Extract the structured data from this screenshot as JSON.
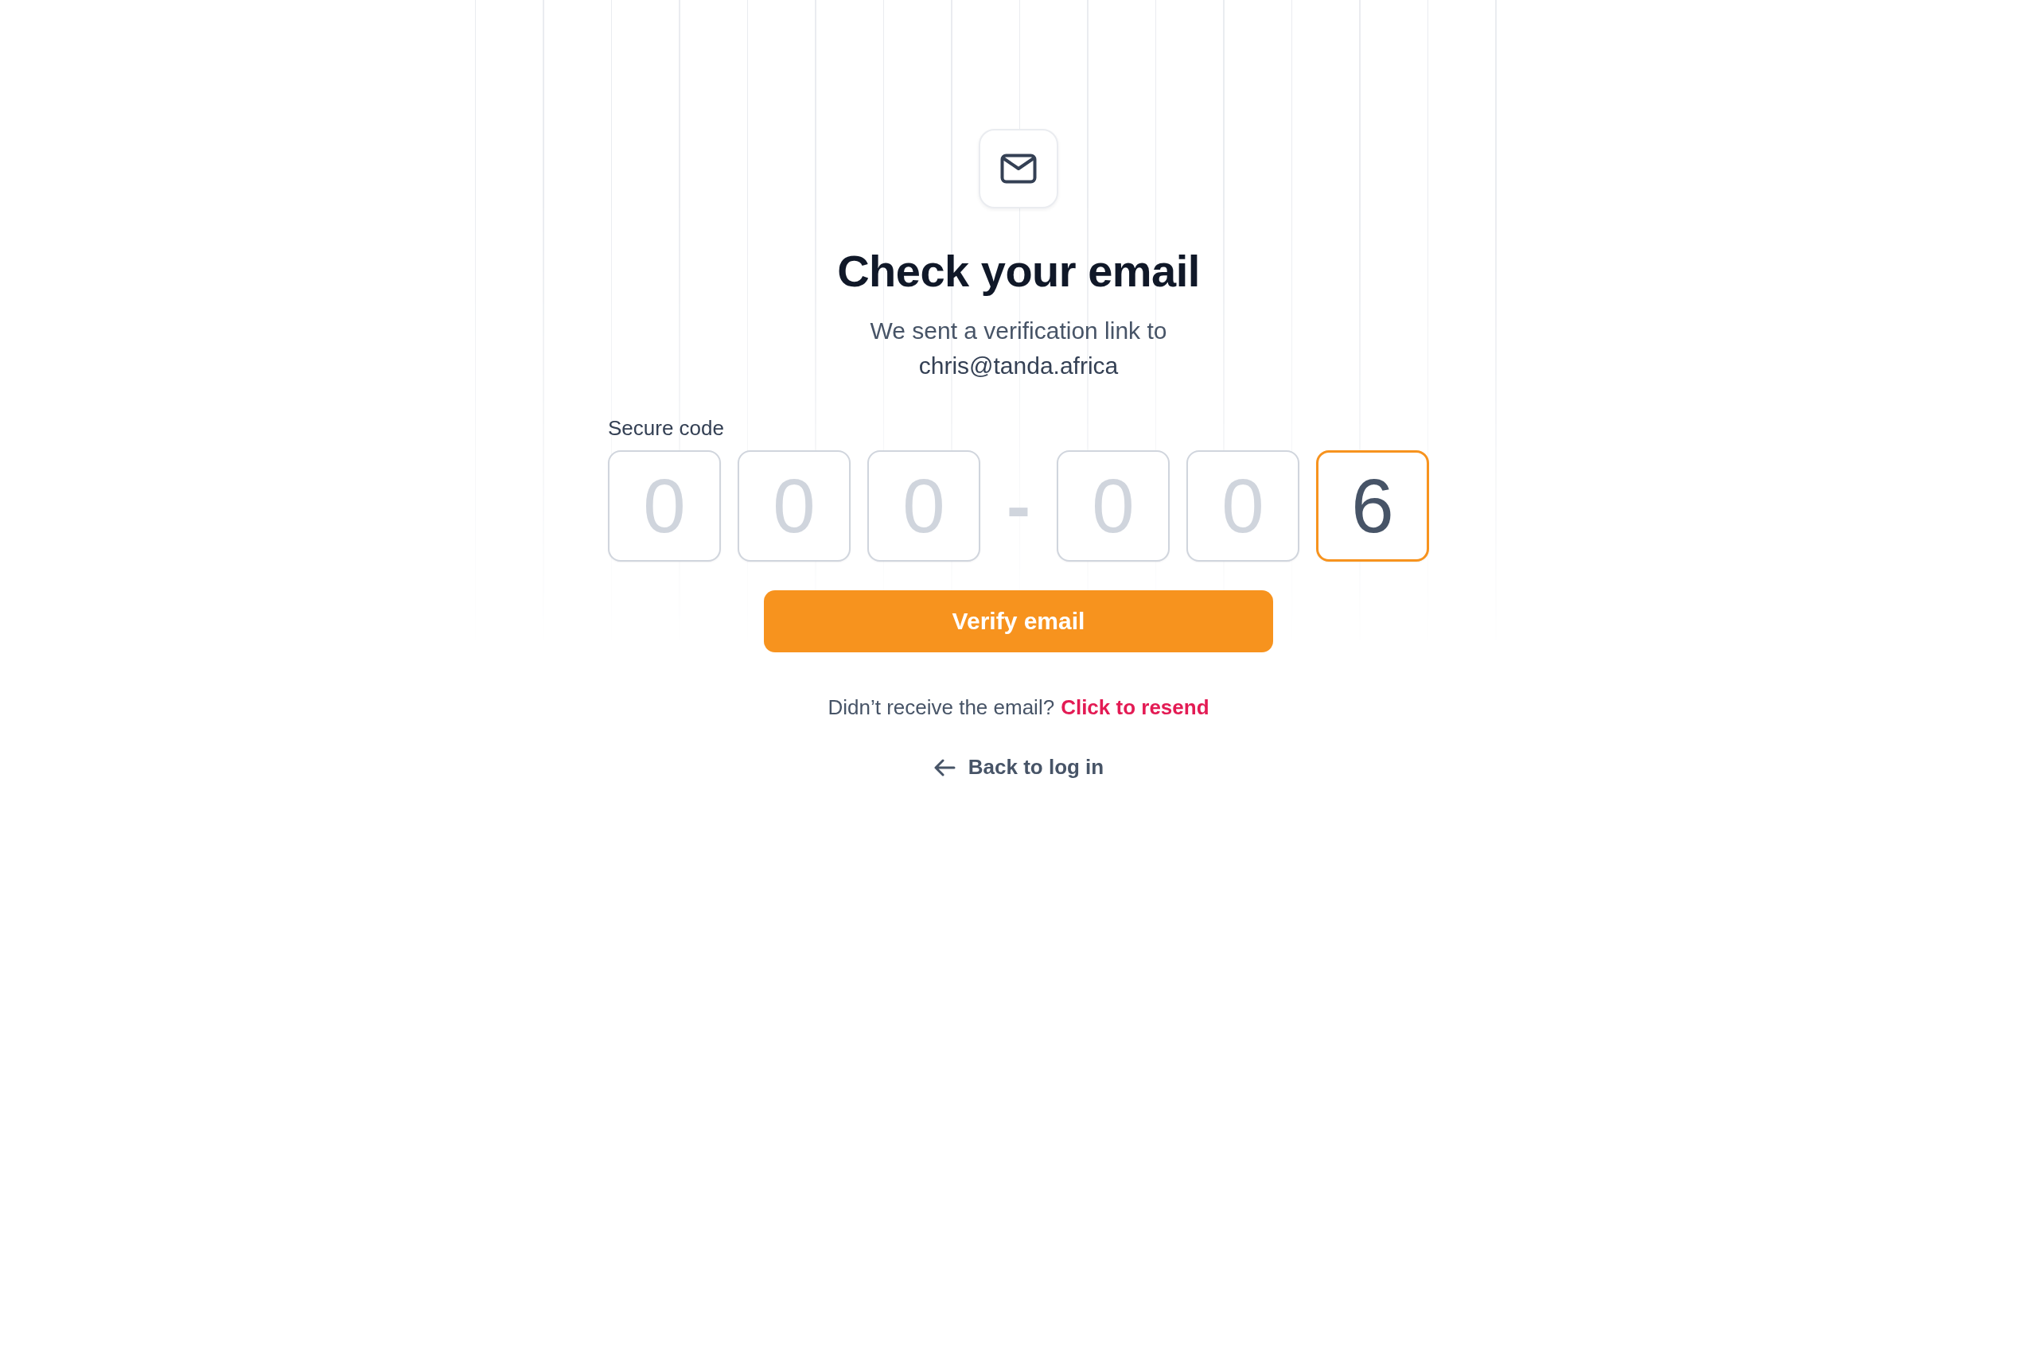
{
  "title": "Check your email",
  "subtitle": "We sent a verification link to",
  "email": "chris@tanda.africa",
  "code": {
    "label": "Secure code",
    "separator": "-",
    "digits": [
      {
        "placeholder": "0",
        "focused": false
      },
      {
        "placeholder": "0",
        "focused": false
      },
      {
        "placeholder": "0",
        "focused": false
      },
      {
        "placeholder": "0",
        "focused": false
      },
      {
        "placeholder": "0",
        "focused": false
      },
      {
        "value": "6",
        "focused": true
      }
    ]
  },
  "verify_button": "Verify email",
  "resend": {
    "text": "Didn’t receive the email?",
    "link": "Click to resend"
  },
  "back_link": "Back to log in"
}
